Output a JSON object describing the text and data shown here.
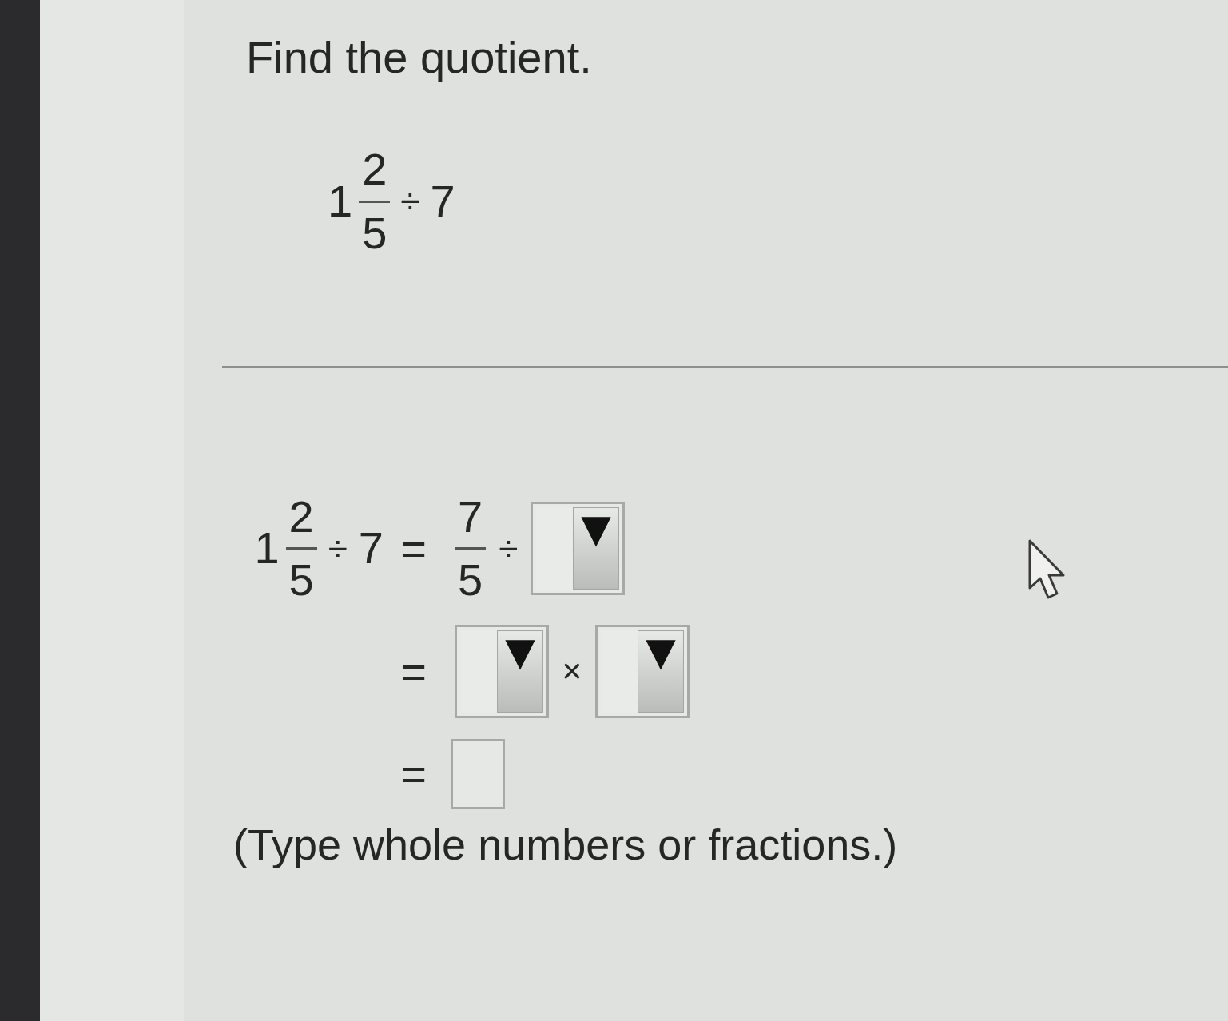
{
  "question": {
    "prompt": "Find the quotient.",
    "expression": [
      {
        "kind": "mixed",
        "whole": "1",
        "numerator": "2",
        "denominator": "5"
      },
      {
        "kind": "operator",
        "text": "÷"
      },
      {
        "kind": "number",
        "text": "7"
      }
    ]
  },
  "answer": {
    "lines": [
      {
        "left": [
          {
            "kind": "mixed",
            "whole": "1",
            "numerator": "2",
            "denominator": "5"
          },
          {
            "kind": "operator",
            "text": "÷"
          },
          {
            "kind": "number",
            "text": "7"
          }
        ],
        "equals": "=",
        "right": [
          {
            "kind": "fraction",
            "numerator": "7",
            "denominator": "5"
          },
          {
            "kind": "operator",
            "text": "÷"
          },
          {
            "kind": "dropdown"
          }
        ]
      },
      {
        "equals": "=",
        "right": [
          {
            "kind": "dropdown"
          },
          {
            "kind": "operator",
            "text": "×"
          },
          {
            "kind": "dropdown"
          }
        ]
      },
      {
        "equals": "=",
        "right": [
          {
            "kind": "input"
          }
        ]
      }
    ],
    "note": "(Type whole numbers or fractions.)"
  }
}
